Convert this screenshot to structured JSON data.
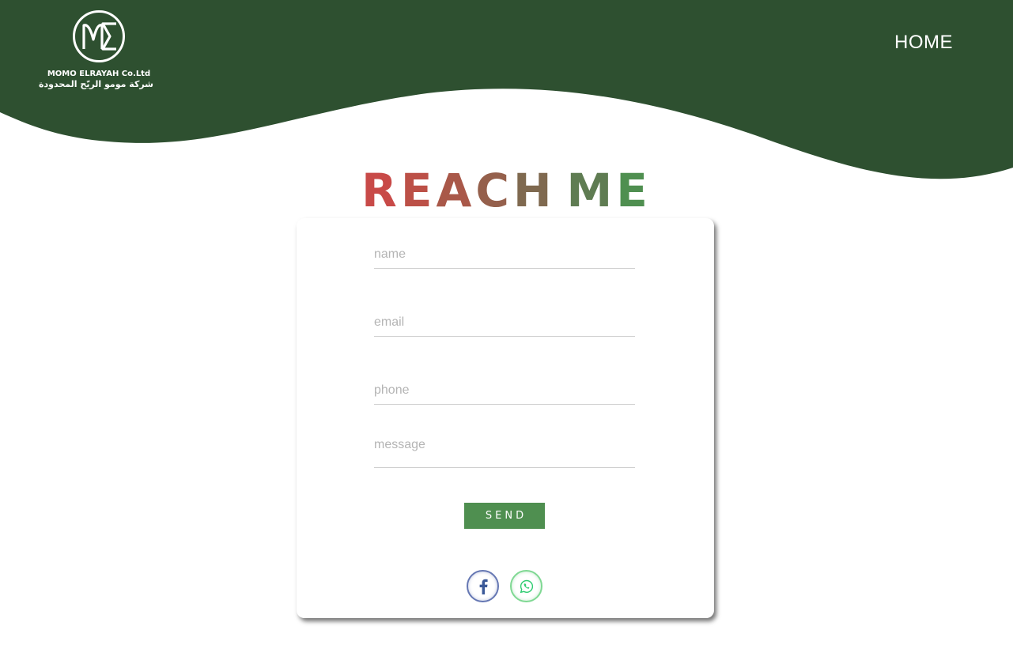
{
  "header": {
    "brand_en": "MOMO ELRAYAH Co.Ltd",
    "brand_ar": "شركة مومو الريّح المحدودة",
    "nav_home": "HOME",
    "background_color": "#2e5030",
    "logo_icon": "me-monogram-icon"
  },
  "title": {
    "letters": [
      "R",
      "E",
      "A",
      "C",
      "H",
      " ",
      "M",
      "E"
    ],
    "colors": [
      "#c84a48",
      "#bc5047",
      "#a95849",
      "#95604c",
      "#7f694f",
      " ",
      "#5f7c52",
      "#4f8f50"
    ]
  },
  "form": {
    "name_placeholder": "name",
    "email_placeholder": "email",
    "phone_placeholder": "phone",
    "message_placeholder": "message",
    "send_label": "SEND",
    "send_color": "#4f8f50"
  },
  "social": {
    "facebook_icon": "facebook-icon",
    "facebook_color": "#3b5998",
    "whatsapp_icon": "whatsapp-icon",
    "whatsapp_color": "#2ecc71"
  }
}
